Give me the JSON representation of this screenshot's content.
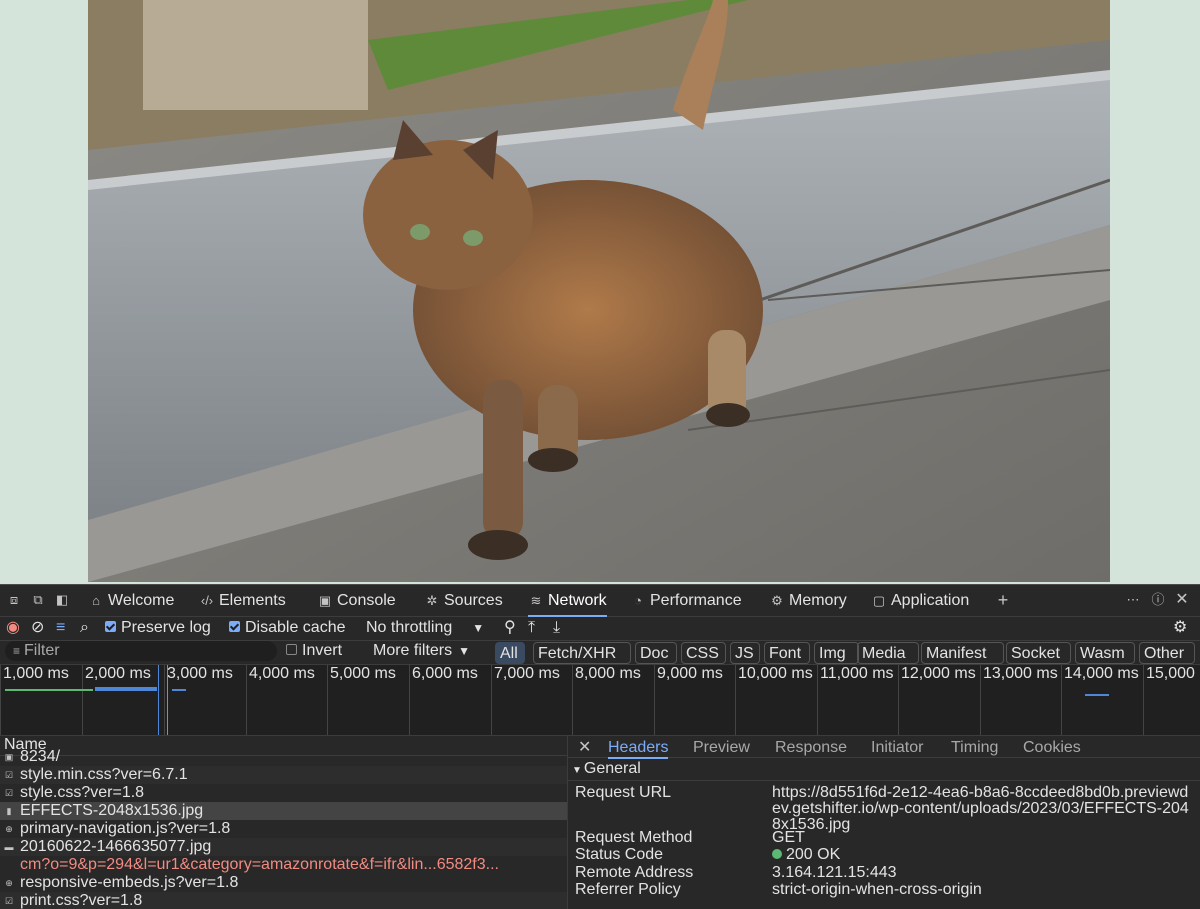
{
  "photo": {
    "alt": "Tortoiseshell tabby cat walking on a concrete sidewalk"
  },
  "devtools": {
    "tabs": [
      {
        "label": "Welcome",
        "icon": "house-icon"
      },
      {
        "label": "Elements",
        "icon": "code-icon"
      },
      {
        "label": "Console",
        "icon": "console-icon"
      },
      {
        "label": "Sources",
        "icon": "bug-icon"
      },
      {
        "label": "Network",
        "icon": "wifi-icon",
        "active": true
      },
      {
        "label": "Performance",
        "icon": "gauge-icon"
      },
      {
        "label": "Memory",
        "icon": "gear-chip-icon"
      },
      {
        "label": "Application",
        "icon": "window-icon"
      }
    ],
    "toolbar": {
      "preserve_log": "Preserve log",
      "disable_cache": "Disable cache",
      "throttling": "No throttling"
    },
    "filter": {
      "placeholder": "Filter",
      "invert": "Invert",
      "more_filters": "More filters",
      "types": [
        "All",
        "Fetch/XHR",
        "Doc",
        "CSS",
        "JS",
        "Font",
        "Img",
        "Media",
        "Manifest",
        "Socket",
        "Wasm",
        "Other"
      ]
    },
    "timeline": {
      "ticks": [
        "1,000 ms",
        "2,000 ms",
        "3,000 ms",
        "4,000 ms",
        "5,000 ms",
        "6,000 ms",
        "7,000 ms",
        "8,000 ms",
        "9,000 ms",
        "10,000 ms",
        "11,000 ms",
        "12,000 ms",
        "13,000 ms",
        "14,000 ms",
        "15,000"
      ]
    },
    "requests": {
      "header": "Name",
      "items": [
        {
          "name": "8234/",
          "partial": true
        },
        {
          "name": "style.min.css?ver=6.7.1"
        },
        {
          "name": "style.css?ver=1.8"
        },
        {
          "name": "EFFECTS-2048x1536.jpg",
          "selected": true
        },
        {
          "name": "primary-navigation.js?ver=1.8"
        },
        {
          "name": "20160622-1466635077.jpg"
        },
        {
          "name": "cm?o=9&p=294&l=ur1&category=amazonrotate&f=ifr&lin...6582f3...",
          "error": true
        },
        {
          "name": "responsive-embeds.js?ver=1.8"
        },
        {
          "name": "print.css?ver=1.8"
        }
      ]
    },
    "details": {
      "tabs": [
        "Headers",
        "Preview",
        "Response",
        "Initiator",
        "Timing",
        "Cookies"
      ],
      "section": "General",
      "request_url_label": "Request URL",
      "request_url": "https://8d551f6d-2e12-4ea6-b8a6-8ccdeed8bd0b.previewdev.getshifter.io/wp-content/uploads/2023/03/EFFECTS-2048x1536.jpg",
      "request_method_label": "Request Method",
      "request_method": "GET",
      "status_code_label": "Status Code",
      "status_code": "200 OK",
      "remote_address_label": "Remote Address",
      "remote_address": "3.164.121.15:443",
      "referrer_policy_label": "Referrer Policy",
      "referrer_policy": "strict-origin-when-cross-origin"
    }
  }
}
